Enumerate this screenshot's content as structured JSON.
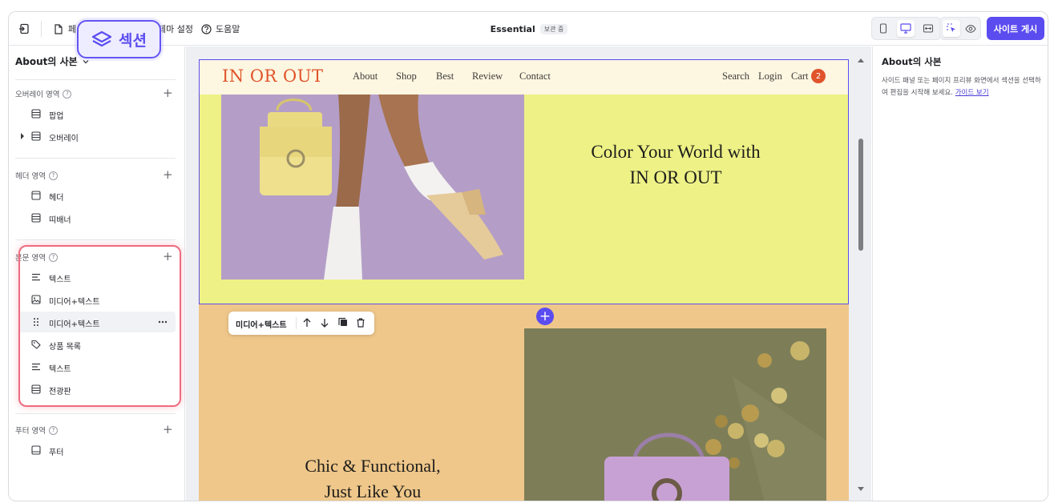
{
  "app": {
    "site_name": "Essential",
    "site_status": "보관 중",
    "page_menu_label": "페",
    "theme_settings_label": "테마 설정",
    "help_label": "도움말",
    "publish_label": "사이트 게시",
    "section_highlight_label": "섹션",
    "accent_color": "#5b4cf0"
  },
  "left_panel": {
    "page_title": "About의 사본",
    "groups": [
      {
        "title": "오버레이 영역",
        "items": [
          {
            "label": "팝업",
            "icon": "section-icon"
          },
          {
            "label": "오버레이",
            "icon": "section-icon"
          }
        ]
      },
      {
        "title": "헤더 영역",
        "items": [
          {
            "label": "헤더",
            "icon": "header-icon"
          },
          {
            "label": "띠배너",
            "icon": "section-icon"
          }
        ]
      },
      {
        "title": "본문 영역",
        "items": [
          {
            "label": "텍스트",
            "icon": "text-icon"
          },
          {
            "label": "미디어+텍스트",
            "icon": "image-icon"
          },
          {
            "label": "미디어+텍스트",
            "icon": "drag-handle-icon",
            "selected": true
          },
          {
            "label": "상품 목록",
            "icon": "tag-icon"
          },
          {
            "label": "텍스트",
            "icon": "text-icon"
          },
          {
            "label": "전광판",
            "icon": "section-icon"
          }
        ]
      },
      {
        "title": "푸터 영역",
        "items": [
          {
            "label": "푸터",
            "icon": "footer-icon"
          }
        ]
      }
    ]
  },
  "preview": {
    "logo": "IN OR OUT",
    "nav": [
      "About",
      "Shop",
      "Best",
      "Review",
      "Contact"
    ],
    "nav_right": [
      "Search",
      "Login",
      "Cart"
    ],
    "cart_count": "2",
    "hero_line1": "Color Your World with",
    "hero_line2": "IN OR OUT",
    "section2_line1": "Chic & Functional,",
    "section2_line2": "Just Like You",
    "section_toolbar_label": "미디어+텍스트",
    "colors": {
      "nav_bg": "#fdf6e1",
      "hero_bg": "#eef286",
      "section2_bg": "#efc78a",
      "logo": "#e0542b"
    }
  },
  "right_panel": {
    "title": "About의 사본",
    "description": "사이드 패널 또는 페이지 프리뷰 화면에서 섹션을 선택하여 편집을 시작해 보세요. ",
    "link": "가이드 보기"
  }
}
